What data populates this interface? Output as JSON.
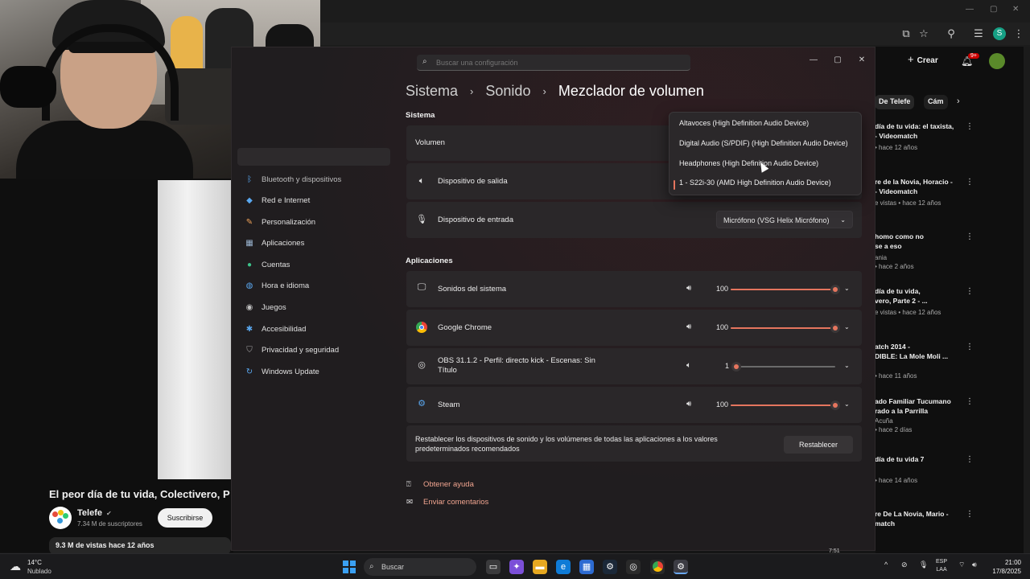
{
  "browser": {
    "youtube": {
      "video_title": "El peor día de tu vida, Colectivero, Par",
      "channel_name": "Telefe",
      "channel_verified": "✔",
      "subscribers": "7.34 M de suscriptores",
      "subscribe_label": "Suscribirse",
      "views_line": "9.3 M de vistas  hace 12 años",
      "create_label": "Crear",
      "notif_badge": "9+",
      "chips": [
        "De Telefe",
        "Cám"
      ],
      "recommendations": [
        {
          "title1": "día de tu vida: el taxista,",
          "title2": "- Videomatch",
          "meta": "• hace 12 años"
        },
        {
          "title1": "re de la Novia, Horacio -",
          "title2": "- Videomatch",
          "meta": "e vistas • hace 12 años"
        },
        {
          "title1": "homo como no",
          "title2": "se a eso",
          "meta": "ania",
          "meta2": "• hace 2 años"
        },
        {
          "title1": "día de tu vida,",
          "title2": "vero, Parte 2 - ...",
          "meta": "e vistas • hace 12 años"
        },
        {
          "title1": "atch 2014 -",
          "title2": "DIBLE: La Mole Moli ...",
          "meta": "• hace 11 años"
        },
        {
          "title1": "ado Familiar Tucumano",
          "title2": "rado a la Parrilla",
          "meta": "Acuña",
          "meta2": "• hace 2 días"
        },
        {
          "title1": "día de tu vida 7",
          "title2": "",
          "meta": "• hace 14 años"
        },
        {
          "title1": "re De La Novia, Mario -",
          "title2": "match",
          "meta": ""
        }
      ]
    }
  },
  "settings": {
    "search_placeholder": "Buscar una configuración",
    "breadcrumb": [
      "Sistema",
      "Sonido",
      "Mezclador de volumen"
    ],
    "sidebar": [
      {
        "label": "Bluetooth y dispositivos",
        "icon": "bluetooth-icon"
      },
      {
        "label": "Red e Internet",
        "icon": "wifi-icon"
      },
      {
        "label": "Personalización",
        "icon": "brush-icon"
      },
      {
        "label": "Aplicaciones",
        "icon": "apps-icon"
      },
      {
        "label": "Cuentas",
        "icon": "person-icon"
      },
      {
        "label": "Hora e idioma",
        "icon": "globe-icon"
      },
      {
        "label": "Juegos",
        "icon": "gamepad-icon"
      },
      {
        "label": "Accesibilidad",
        "icon": "accessibility-icon"
      },
      {
        "label": "Privacidad y seguridad",
        "icon": "shield-icon"
      },
      {
        "label": "Windows Update",
        "icon": "update-icon"
      }
    ],
    "system_section": "Sistema",
    "volume_label": "Volumen",
    "output_label": "Dispositivo de salida",
    "input_label": "Dispositivo de entrada",
    "input_value": "Micrófono (VSG Helix Micrófono)",
    "output_options": [
      "Altavoces (High Definition Audio Device)",
      "Digital Audio (S/PDIF) (High Definition Audio Device)",
      "Headphones (High Definition Audio Device)",
      "1 - S22i-30 (AMD High Definition Audio Device)"
    ],
    "output_selected_index": 3,
    "apps_section": "Aplicaciones",
    "apps": [
      {
        "name": "Sonidos del sistema",
        "line2": "",
        "volume": 100,
        "display": "100"
      },
      {
        "name": "Google Chrome",
        "line2": "",
        "volume": 100,
        "display": "100"
      },
      {
        "name": "OBS 31.1.2 - Perfil: directo kick - Escenas: Sin",
        "line2": "Título",
        "volume": 1,
        "display": "1"
      },
      {
        "name": "Steam",
        "line2": "",
        "volume": 100,
        "display": "100"
      }
    ],
    "reset_text1": "Restablecer los dispositivos de sonido y los volúmenes de todas las aplicaciones a los valores",
    "reset_text2": "predeterminados recomendados",
    "reset_button": "Restablecer",
    "help_link": "Obtener ayuda",
    "feedback_link": "Enviar comentarios"
  },
  "taskbar": {
    "temperature": "14°C",
    "weather_desc": "Nublado",
    "search_label": "Buscar",
    "lang1": "ESP",
    "lang2": "LAA",
    "time": "21:00",
    "date": "17/8/2025",
    "mini_time": "7:51"
  },
  "colors": {
    "accent": "#e5755e",
    "window_bg": "#201d1f",
    "card_bg": "#2a2729"
  }
}
